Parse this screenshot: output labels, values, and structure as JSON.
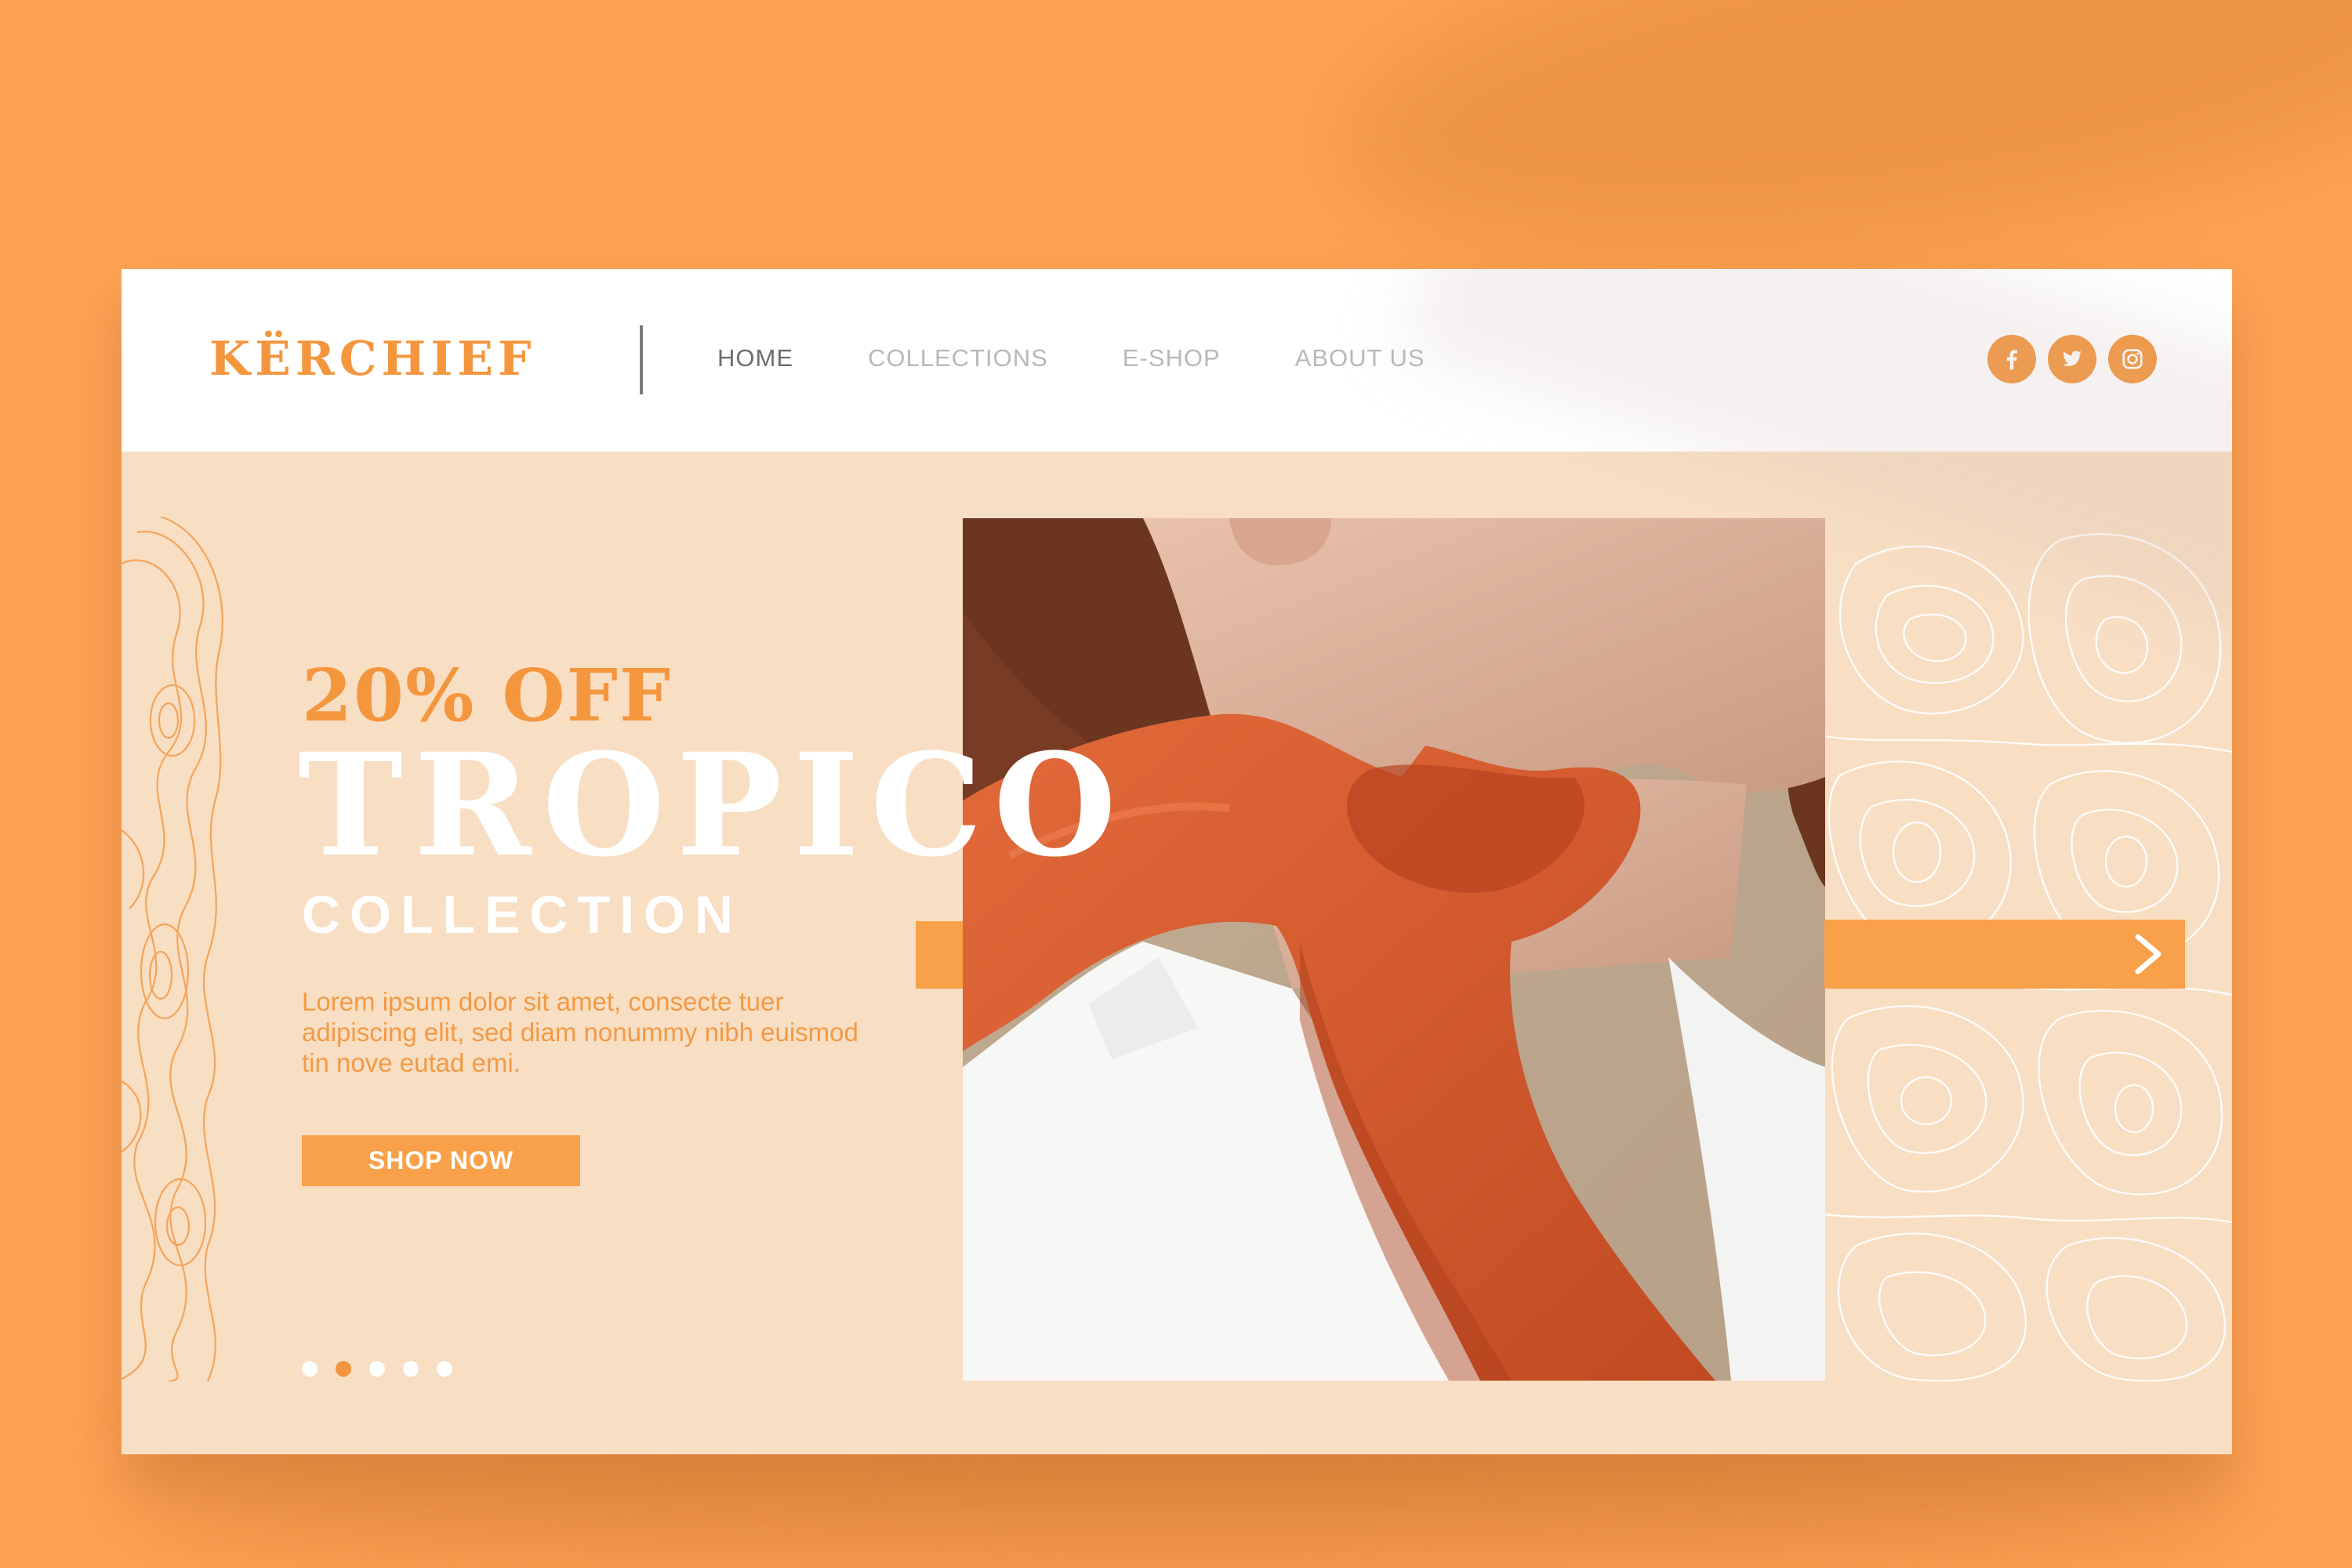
{
  "brand": {
    "logo": "KËRCHIEF"
  },
  "nav": {
    "items": [
      {
        "label": "HOME",
        "active": true
      },
      {
        "label": "COLLECTIONS",
        "active": false
      },
      {
        "label": "E-SHOP",
        "active": false
      },
      {
        "label": "ABOUT US",
        "active": false
      }
    ]
  },
  "social": {
    "icons": [
      "facebook-icon",
      "twitter-icon",
      "instagram-icon"
    ]
  },
  "hero": {
    "discount": "20% OFF",
    "title": "TROPICO",
    "subtitle": "COLLECTION",
    "description": "Lorem ipsum dolor sit amet, consecte tuer adipiscing elit, sed diam nonummy nibh euismod tin nove eutad emi.",
    "cta_label": "SHOP NOW"
  },
  "carousel": {
    "slide_count": 5,
    "active_index": 1
  },
  "colors": {
    "background": "#fea355",
    "page": "#f8dec3",
    "accent": "#f4963e",
    "header": "#ffffff",
    "scarf": "#d95c2f"
  }
}
